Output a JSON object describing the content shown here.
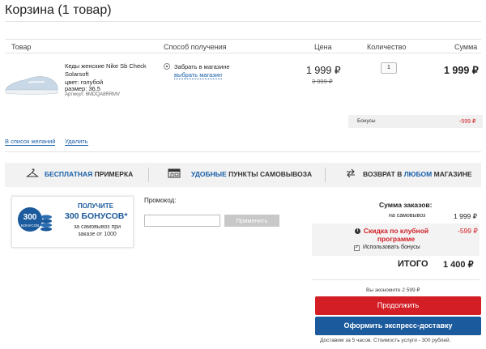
{
  "page": {
    "title": "Корзина (1 товар)"
  },
  "table_headers": {
    "product": "Товар",
    "delivery": "Способ получения",
    "price": "Цена",
    "quantity": "Количество",
    "sum": "Сумма"
  },
  "item": {
    "name": "Кеды женские Nike Sb Check Solarsoft",
    "color": "цвет: голубой",
    "size": "размер: 36,5",
    "article": "Артикул: 6MDQA8RRMV",
    "pickup_option": "Забрать в магазине",
    "choose_store": "выбрать магазин",
    "price": "1 999 ₽",
    "old_price": "3 999 ₽",
    "quantity": "1",
    "sum": "1 999 ₽"
  },
  "bonus": {
    "label": "Бонусы",
    "value": "-599 ₽"
  },
  "actions": {
    "wishlist": "В список желаний",
    "delete": "Удалить"
  },
  "features": {
    "fitting_hl": "БЕСПЛАТНАЯ",
    "fitting": "ПРИМЕРКА",
    "pickup_hl": "УДОБНЫЕ",
    "pickup": "ПУНКТЫ САМОВЫВОЗА",
    "return": "ВОЗВРАТ В",
    "return_hl": "ЛЮБОМ",
    "return_end": "МАГАЗИНЕ"
  },
  "promo_card": {
    "badge_number": "300",
    "badge_unit": "БОНУСОВ",
    "heading": "ПОЛУЧИТЕ",
    "amount": "300 БОНУСОВ*",
    "text": "за самовывоз при заказе от 1000"
  },
  "promocode": {
    "label": "Промокод:",
    "value": "",
    "apply": "Применить"
  },
  "summary": {
    "title": "Сумма заказов:",
    "pickup_label": "на самовывоз",
    "pickup_value": "1 999 ₽",
    "club_discount_label": "Скидка по клубной программе",
    "club_discount_value": "-599 ₽",
    "use_bonus_label": "Использовать бонусы",
    "use_bonus_checked": "✓",
    "total_label": "ИТОГО",
    "total_value": "1 400 ₽",
    "savings": "Вы экономите 2 599 ₽"
  },
  "buttons": {
    "continue": "Продолжить",
    "express": "Оформить экспресс-доставку"
  },
  "delivery_note": "Доставим за 5 часов. Стоимость услуги - 300 рублей.",
  "colors": {
    "accent_red": "#d31e26",
    "accent_blue": "#1b5a9c",
    "link_blue": "#1a5fa8"
  }
}
